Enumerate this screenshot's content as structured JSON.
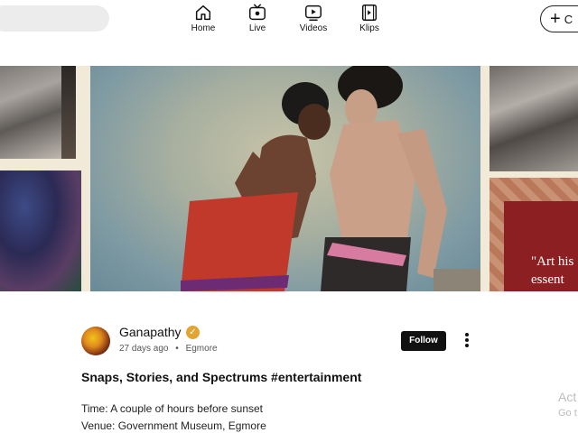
{
  "nav": {
    "items": [
      {
        "label": "Home",
        "icon": "home-icon"
      },
      {
        "label": "Live",
        "icon": "live-tv-icon"
      },
      {
        "label": "Videos",
        "icon": "video-play-icon"
      },
      {
        "label": "Klips",
        "icon": "film-strip-icon"
      }
    ],
    "create_label": "C"
  },
  "collage": {
    "banner_text_line1": "\"Art his",
    "banner_text_line2": "essent"
  },
  "post": {
    "author": "Ganapathy",
    "verified_icon": "verified-badge-icon",
    "age": "27 days ago",
    "location": "Egmore",
    "follow_label": "Follow",
    "title": "Snaps, Stories, and Spectrums #entertainment",
    "body_line1": "Time: A couple of hours before sunset",
    "body_line2": "Venue: Government Museum, Egmore"
  },
  "windows_watermark": {
    "line1": "Act",
    "line2": "Go t"
  },
  "colors": {
    "follow_bg": "#111111",
    "verified": "#e3a531",
    "banner": "#8c1f22"
  }
}
